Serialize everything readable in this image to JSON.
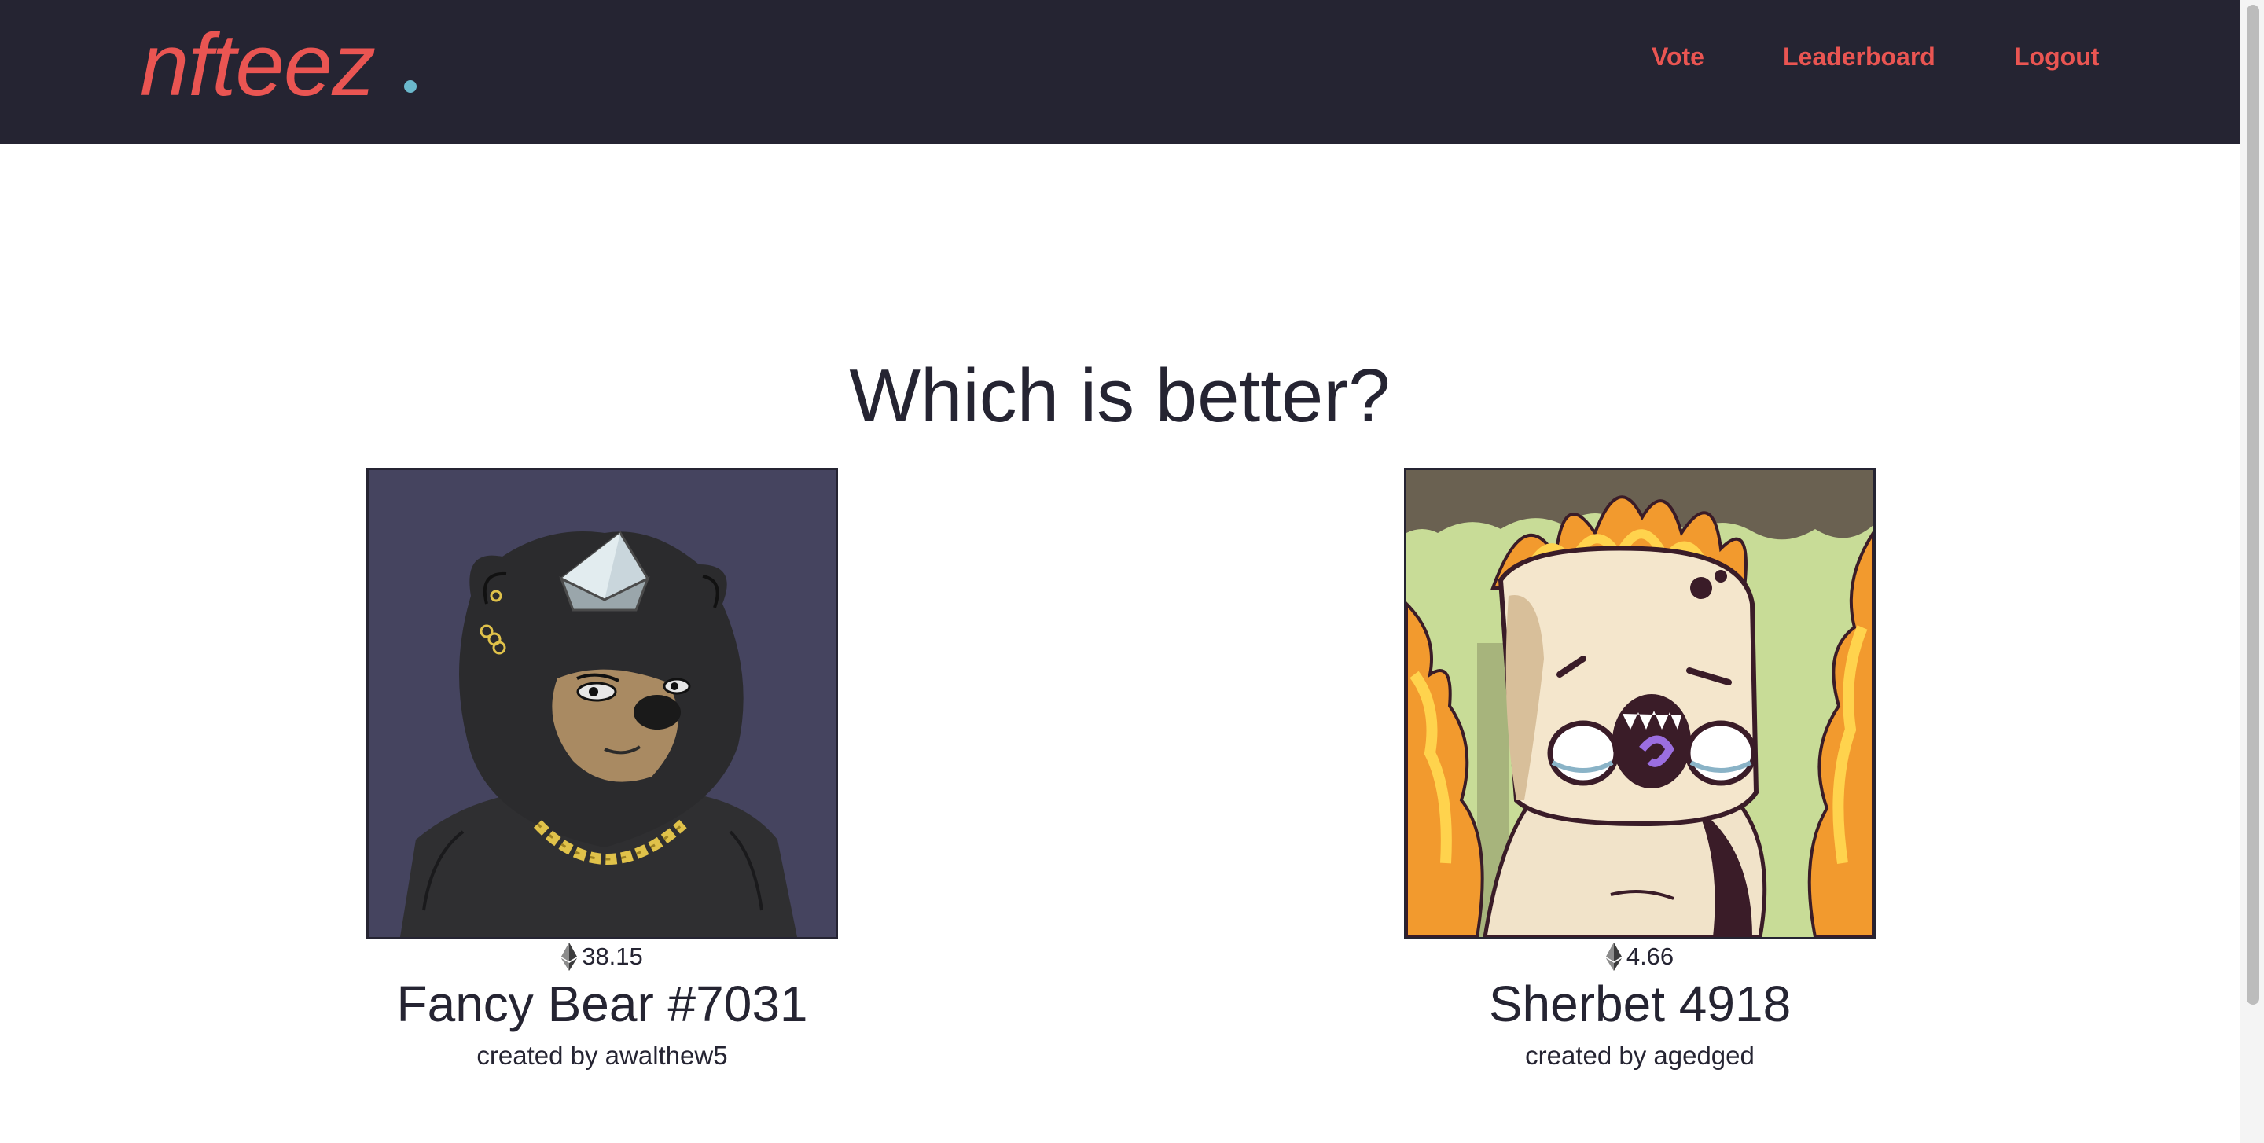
{
  "header": {
    "logo": "nfteez",
    "nav": [
      {
        "label": "Vote"
      },
      {
        "label": "Leaderboard"
      },
      {
        "label": "Logout"
      }
    ]
  },
  "main": {
    "heading": "Which is better?",
    "cards": [
      {
        "price": "38.15",
        "name": "Fancy Bear #7031",
        "creator": "created by awalthew5",
        "image": "bear-nft-art"
      },
      {
        "price": "4.66",
        "name": "Sherbet 4918",
        "creator": "created by agedged",
        "image": "sherbet-nft-art"
      }
    ]
  },
  "colors": {
    "navbar_bg": "#252432",
    "accent": "#ea5552",
    "logo_dot": "#6bb8cc",
    "text": "#252432"
  }
}
